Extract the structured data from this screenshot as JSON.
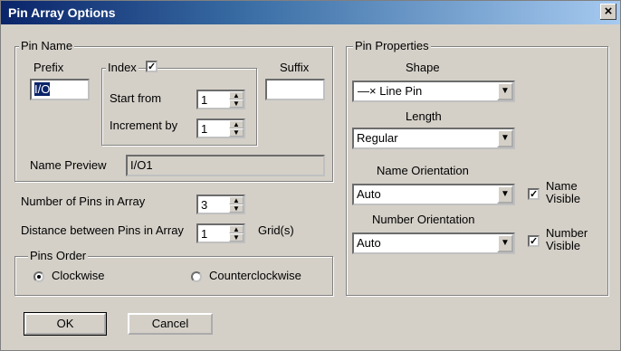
{
  "title": "Pin Array Options",
  "close_glyph": "×",
  "pin_name": {
    "legend": "Pin Name",
    "prefix_label": "Prefix",
    "prefix_value": "I/O",
    "suffix_label": "Suffix",
    "suffix_value": "",
    "index_label": "Index",
    "index_checked": true,
    "start_from_label": "Start from",
    "start_from_value": "1",
    "increment_label": "Increment by",
    "increment_value": "1",
    "preview_label": "Name Preview",
    "preview_value": "I/O1"
  },
  "pins": {
    "count_label": "Number of Pins in Array",
    "count_value": "3",
    "distance_label": "Distance between Pins in Array",
    "distance_value": "1",
    "distance_unit": "Grid(s)"
  },
  "order": {
    "legend": "Pins Order",
    "clockwise": "Clockwise",
    "counterclockwise": "Counterclockwise",
    "selected": "clockwise"
  },
  "props": {
    "legend": "Pin Properties",
    "shape_label": "Shape",
    "shape_value": "Line Pin",
    "length_label": "Length",
    "length_value": "Regular",
    "name_orientation_label": "Name Orientation",
    "name_orientation_value": "Auto",
    "name_visible_line1": "Name",
    "name_visible_line2": "Visible",
    "number_orientation_label": "Number Orientation",
    "number_orientation_value": "Auto",
    "number_visible_line1": "Number",
    "number_visible_line2": "Visible"
  },
  "buttons": {
    "ok": "OK",
    "cancel": "Cancel"
  }
}
